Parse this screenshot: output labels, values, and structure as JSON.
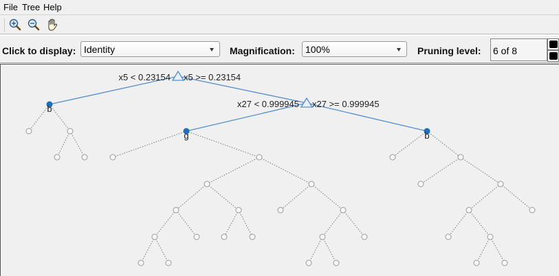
{
  "menu": {
    "items": [
      "File",
      "Tree",
      "Help"
    ]
  },
  "toolbar": {
    "buttons": [
      "zoom-in-icon",
      "zoom-out-icon",
      "pan-hand-icon"
    ]
  },
  "controls": {
    "display_label": "Click to display:",
    "display_value": "Identity",
    "magnification_label": "Magnification:",
    "magnification_value": "100%",
    "pruning_label": "Pruning level:",
    "pruning_value": "6 of 8"
  },
  "tree": {
    "root": {
      "left_label": "x5 < 0.23154",
      "right_label": "x5 >= 0.23154"
    },
    "right_split": {
      "left_label": "x27 < 0.999945",
      "right_label": "x27 >= 0.999945"
    },
    "leaves": {
      "left": "b",
      "middle": "g",
      "right": "b"
    }
  },
  "colors": {
    "active_branch": "#4f8fcf",
    "active_node": "#1f6fc0",
    "pruned": "#888888"
  }
}
